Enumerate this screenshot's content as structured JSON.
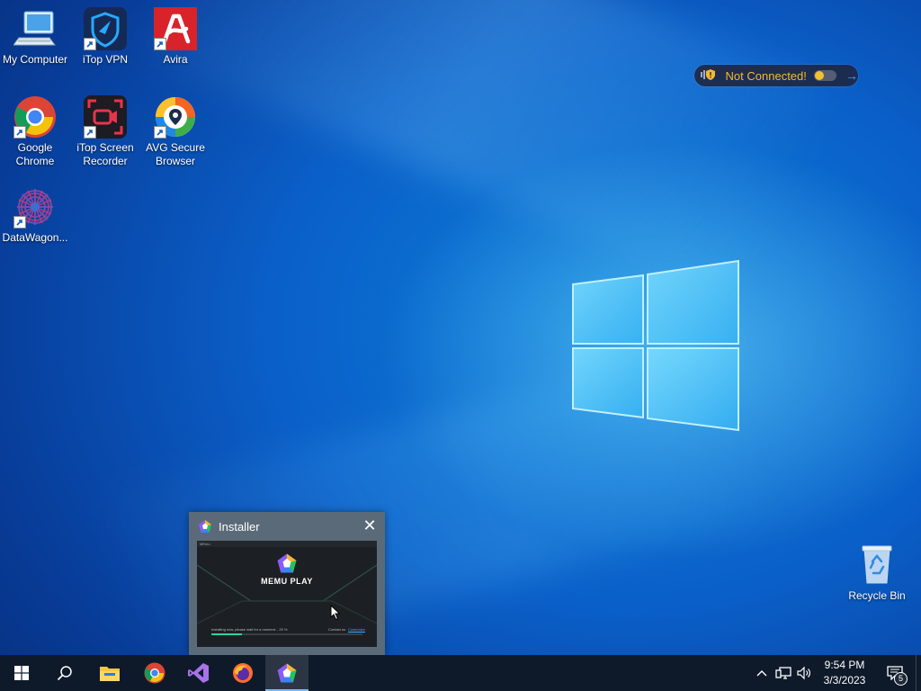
{
  "desktop": {
    "icons": [
      {
        "label": "My Computer",
        "icon": "computer-icon"
      },
      {
        "label": "iTop VPN",
        "icon": "itop-vpn-icon"
      },
      {
        "label": "Avira",
        "icon": "avira-icon"
      },
      {
        "label": "Google Chrome",
        "icon": "chrome-icon"
      },
      {
        "label": "iTop Screen Recorder",
        "icon": "itop-screen-recorder-icon"
      },
      {
        "label": "AVG Secure Browser",
        "icon": "avg-browser-icon"
      },
      {
        "label": "DataWagon...",
        "icon": "datawagon-icon"
      },
      {
        "label": "Recycle Bin",
        "icon": "recycle-bin-icon"
      }
    ]
  },
  "vpn_widget": {
    "status": "Not Connected!",
    "colors": {
      "text": "#f5b82e",
      "toggle_knob": "#f2c12e",
      "arrow": "#3fa9ff"
    }
  },
  "thumbnail": {
    "title": "Installer",
    "preview": {
      "app_name": "MEmu",
      "logo_text": "MEMU PLAY",
      "status_text": "Installing now, please wait for a moment...  20 %",
      "contact_text": "Contact us",
      "customize_text": "Customize",
      "progress": 0.2
    }
  },
  "taskbar": {
    "pinned": [
      "start-icon",
      "search-icon",
      "file-explorer-icon",
      "chrome-icon",
      "visual-studio-icon",
      "firefox-icon",
      "memu-installer-icon"
    ],
    "active": "memu-installer-icon",
    "clock": {
      "time": "9:54 PM",
      "date": "3/3/2023"
    },
    "notifications_count": "5"
  },
  "colors": {
    "taskbar_bg": "#0e1a2a",
    "accent": "#76b9ed",
    "desktop_blue": "#0a5fc8"
  }
}
